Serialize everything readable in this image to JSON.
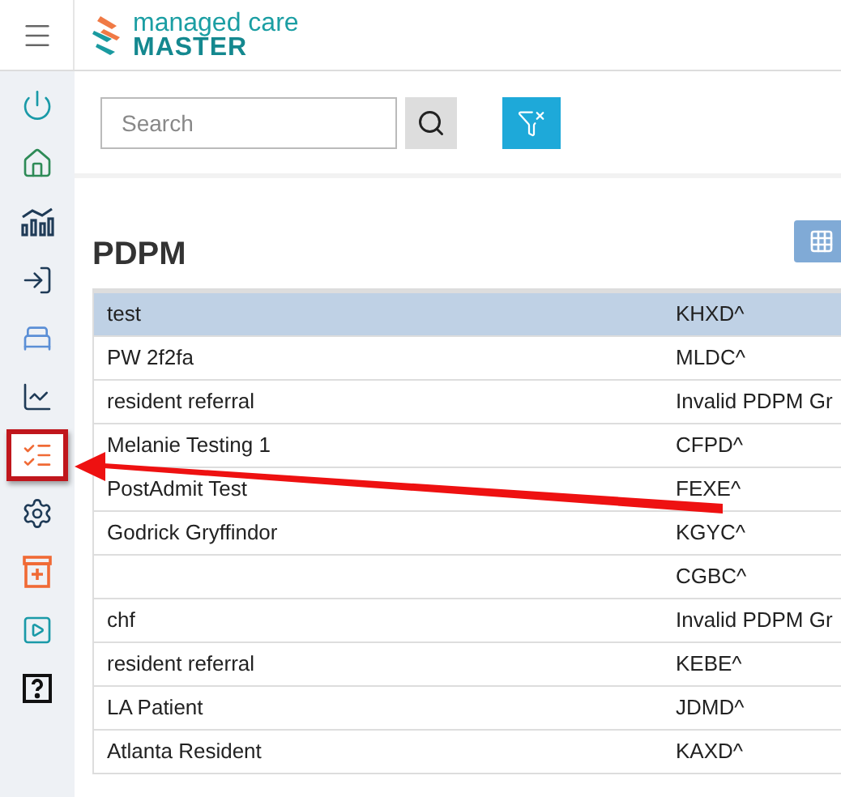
{
  "logo": {
    "line_1": "managed care",
    "line_2": "MASTER"
  },
  "sidebar": {
    "items": [
      {
        "kind": "power",
        "highlighted": false
      },
      {
        "kind": "home",
        "highlighted": false
      },
      {
        "kind": "analytics",
        "highlighted": false
      },
      {
        "kind": "login",
        "highlighted": false
      },
      {
        "kind": "bed",
        "highlighted": false
      },
      {
        "kind": "trend",
        "highlighted": false
      },
      {
        "kind": "checklist",
        "highlighted": true
      },
      {
        "kind": "settings",
        "highlighted": false
      },
      {
        "kind": "archive",
        "highlighted": false
      },
      {
        "kind": "play",
        "highlighted": false
      },
      {
        "kind": "help",
        "highlighted": false
      }
    ]
  },
  "search": {
    "placeholder": "Search"
  },
  "page_title": "PDPM",
  "table": {
    "rows": [
      {
        "column_1": "test",
        "column_2": "KHXD^",
        "selected": true
      },
      {
        "column_1": "PW 2f2fa",
        "column_2": "MLDC^",
        "selected": false
      },
      {
        "column_1": "resident referral",
        "column_2": "Invalid PDPM Gr",
        "selected": false
      },
      {
        "column_1": "Melanie Testing 1",
        "column_2": "CFPD^",
        "selected": false
      },
      {
        "column_1": "PostAdmit Test",
        "column_2": "FEXE^",
        "selected": false
      },
      {
        "column_1": "Godrick Gryffindor",
        "column_2": "KGYC^",
        "selected": false
      },
      {
        "column_1": "",
        "column_2": "CGBC^",
        "selected": false
      },
      {
        "column_1": "chf",
        "column_2": "Invalid PDPM Gr",
        "selected": false
      },
      {
        "column_1": "resident referral",
        "column_2": "KEBE^",
        "selected": false
      },
      {
        "column_1": "LA Patient",
        "column_2": "JDMD^",
        "selected": false
      },
      {
        "column_1": "Atlanta Resident",
        "column_2": "KAXD^",
        "selected": false
      }
    ]
  }
}
